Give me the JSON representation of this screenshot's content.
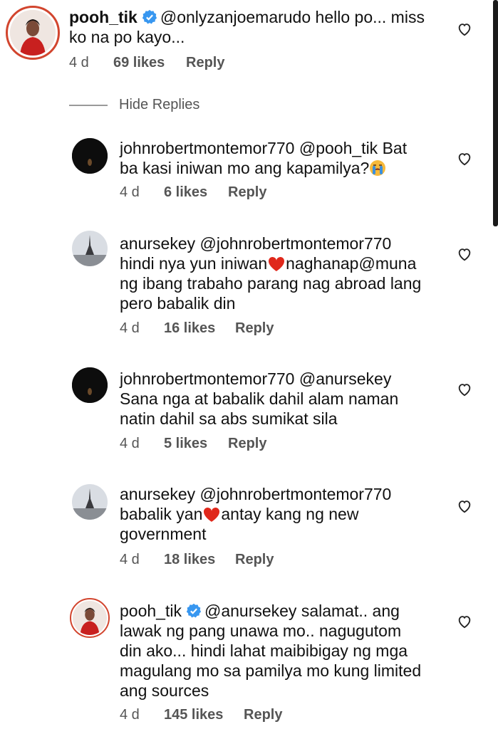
{
  "hide_replies_label": "Hide Replies",
  "colors": {
    "heart": "#e0281b",
    "verified": "#3897f0",
    "story_ring": "#d2452e"
  },
  "comments": [
    {
      "username": "pooh_tik",
      "verified": true,
      "mention": "@onlyzanjoemarudo",
      "line1": " hello po... miss",
      "lines": [
        "ko na po kayo..."
      ],
      "time": "4 d",
      "likes": "69 likes",
      "reply": "Reply"
    },
    {
      "username": "johnrobertmontemor770",
      "verified": false,
      "mention": "@pooh_tik",
      "line1": " Bat",
      "lines": [
        "ba kasi iniwan mo ang kapamilya?"
      ],
      "emoji": "crying-face-icon",
      "time": "4 d",
      "likes": "6 likes",
      "reply": "Reply"
    },
    {
      "username": "anursekey",
      "verified": false,
      "mention": "@johnrobertmontemor770",
      "line1": "",
      "line2_a": "hindi nya yun iniwan",
      "line2_b": "naghanap@muna",
      "lines": [
        "ng ibang trabaho parang nag abroad lang",
        "pero babalik din"
      ],
      "time": "4 d",
      "likes": "16 likes",
      "reply": "Reply"
    },
    {
      "username": "johnrobertmontemor770",
      "verified": false,
      "mention": "@anursekey",
      "line1": "",
      "lines": [
        "Sana nga at babalik dahil alam naman",
        "natin dahil sa abs sumikat sila"
      ],
      "time": "4 d",
      "likes": "5 likes",
      "reply": "Reply"
    },
    {
      "username": "anursekey",
      "verified": false,
      "mention": "@johnrobertmontemor770",
      "line1": "",
      "line2_a": "babalik yan",
      "line2_b": "antay kang ng new",
      "lines": [
        "government"
      ],
      "time": "4 d",
      "likes": "18 likes",
      "reply": "Reply"
    },
    {
      "username": "pooh_tik",
      "verified": true,
      "mention": "@anursekey",
      "line1": " salamat.. ang",
      "lines": [
        "lawak ng pang unawa mo.. nagugutom",
        "din ako... hindi lahat maibibigay ng mga",
        "magulang mo sa pamilya mo kung limited",
        "ang sources"
      ],
      "time": "4 d",
      "likes": "145 likes",
      "reply": "Reply"
    }
  ]
}
